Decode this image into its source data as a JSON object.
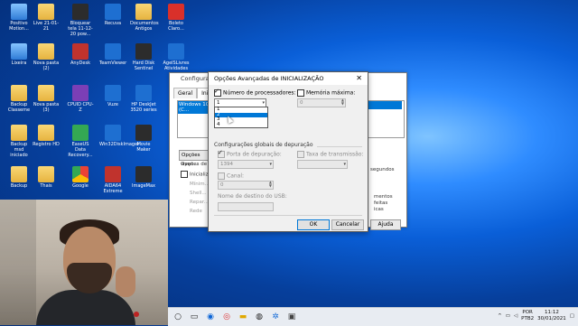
{
  "desktop": {
    "icons": [
      {
        "label": "Positivo Motion...",
        "type": "pc"
      },
      {
        "label": "Live 21-01-21",
        "type": "folder"
      },
      {
        "label": "Bloquear tela 11-12-20 pow...",
        "type": "app-dark"
      },
      {
        "label": "Recuva",
        "type": "app-blue"
      },
      {
        "label": "Documentos Antigos",
        "type": "folder"
      },
      {
        "label": "Boleto Claro...",
        "type": "pdf"
      },
      {
        "label": "Lixeira",
        "type": "pc"
      },
      {
        "label": "Nova pasta (2)",
        "type": "folder"
      },
      {
        "label": "AnyDesk",
        "type": "app-red"
      },
      {
        "label": "TeamViewer",
        "type": "app-blue"
      },
      {
        "label": "Hard Disk Sentinel",
        "type": "app-dark"
      },
      {
        "label": "AgelSLivres Atividades",
        "type": "app-blue"
      },
      {
        "label": "Backup Classeme",
        "type": "folder"
      },
      {
        "label": "Nova pasta (3)",
        "type": "folder"
      },
      {
        "label": "CPUID CPU-Z",
        "type": "app-purple"
      },
      {
        "label": "Vuze",
        "type": "app-blue"
      },
      {
        "label": "HP DeskJet 3520 series",
        "type": "app-blue"
      },
      {
        "label": "Backup msd iniciado",
        "type": "folder"
      },
      {
        "label": "Registro HD",
        "type": "folder"
      },
      {
        "label": "EaseUS Data Recovery...",
        "type": "app-green"
      },
      {
        "label": "Win32DiskImager",
        "type": "app-blue"
      },
      {
        "label": "Movie Maker",
        "type": "app-dark"
      },
      {
        "label": "Backup",
        "type": "folder"
      },
      {
        "label": "Thais",
        "type": "folder"
      },
      {
        "label": "Google",
        "type": "chrome"
      },
      {
        "label": "AIDA64 Extreme",
        "type": "app-red"
      },
      {
        "label": "ImageMax",
        "type": "app-dark"
      }
    ]
  },
  "bg_window": {
    "title": "Configuraç...",
    "tabs": [
      "Geral",
      "Inicializ..."
    ],
    "list_selected": "Windows 10 (C...",
    "advanced_button": "Opções avan...",
    "group_label": "Opções de ini...",
    "options": [
      "Inicializ...",
      "Mínim...",
      "Shell...",
      "Repar...",
      "Rede"
    ],
    "right_text_1": "segundos",
    "right_text_2a": "mentos feitas",
    "right_text_2b": "icas",
    "bottom_buttons": [
      "",
      "Ajuda"
    ]
  },
  "dialog": {
    "title": "Opções Avançadas de INICIALIZAÇÃO",
    "close_glyph": "✕",
    "num_processors_label": "Número de processadores:",
    "num_processors_value": "1",
    "dropdown_options": [
      "1",
      "2",
      "3",
      "4"
    ],
    "dropdown_highlight_index": 1,
    "max_memory_label": "Memória máxima:",
    "max_memory_value": "0",
    "debug_header": "Configurações globais de depuração",
    "debug_port_label": "Porta de depuração:",
    "debug_port_value": "1394",
    "baud_rate_label": "Taxa de transmissão:",
    "channel_label": "Canal:",
    "channel_value": "0",
    "usb_target_label": "Nome de destino do USB:",
    "ok": "OK",
    "cancel": "Cancelar"
  },
  "taskbar": {
    "language_1": "POR",
    "language_2": "PTB2",
    "time": "11:12",
    "date": "30/01/2021"
  }
}
